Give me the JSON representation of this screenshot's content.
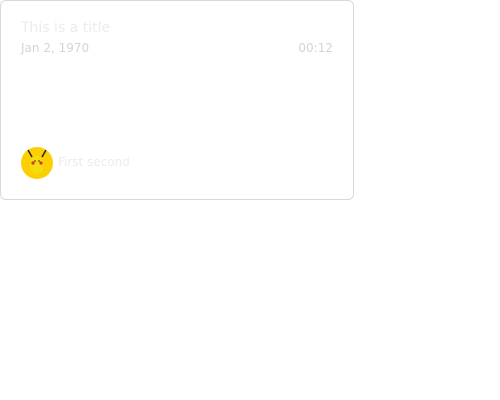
{
  "card": {
    "title": "This is a title",
    "date": "Jan 2, 1970",
    "time": "00:12",
    "author": "First second",
    "avatar_icon": "pikachu-avatar",
    "colors": {
      "avatar_bg": "#fcd000"
    }
  }
}
